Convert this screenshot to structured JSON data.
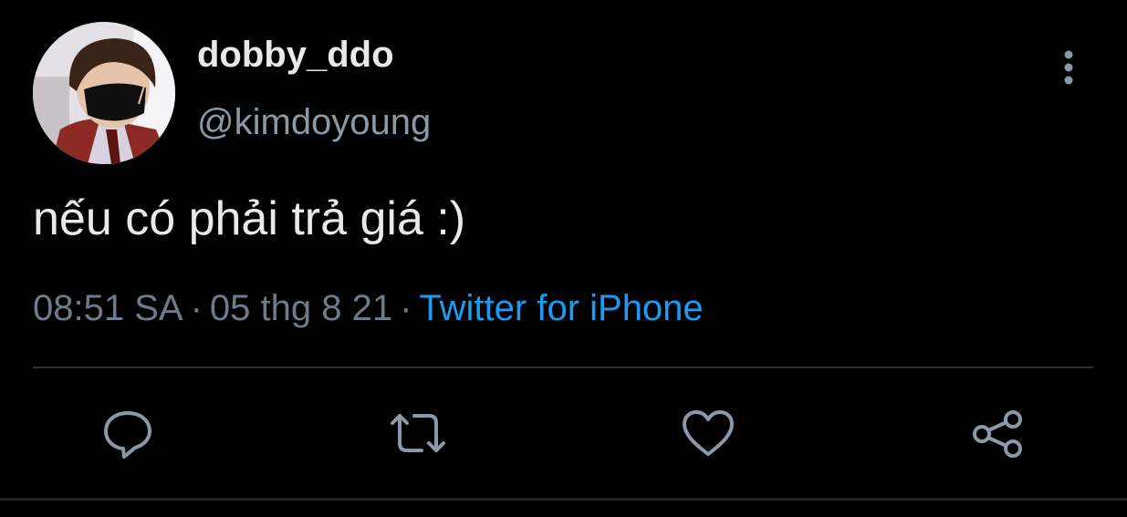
{
  "tweet": {
    "display_name": "dobby_ddo",
    "handle": "@kimdoyoung",
    "text": "nếu có phải trả giá :)",
    "time": "08:51 SA",
    "separator_1": "·",
    "date": "05 thg 8 21",
    "separator_2": "·",
    "source": "Twitter for iPhone"
  },
  "icons": {
    "more": "more-vertical-icon",
    "reply": "reply-icon",
    "retweet": "retweet-icon",
    "like": "heart-icon",
    "share": "share-icon"
  },
  "colors": {
    "background": "#000000",
    "primary_text": "#e7e9ea",
    "secondary_text": "#8b98a5",
    "link": "#1d9bf0",
    "icon": "#8b98a5",
    "divider": "#2a2f33"
  }
}
